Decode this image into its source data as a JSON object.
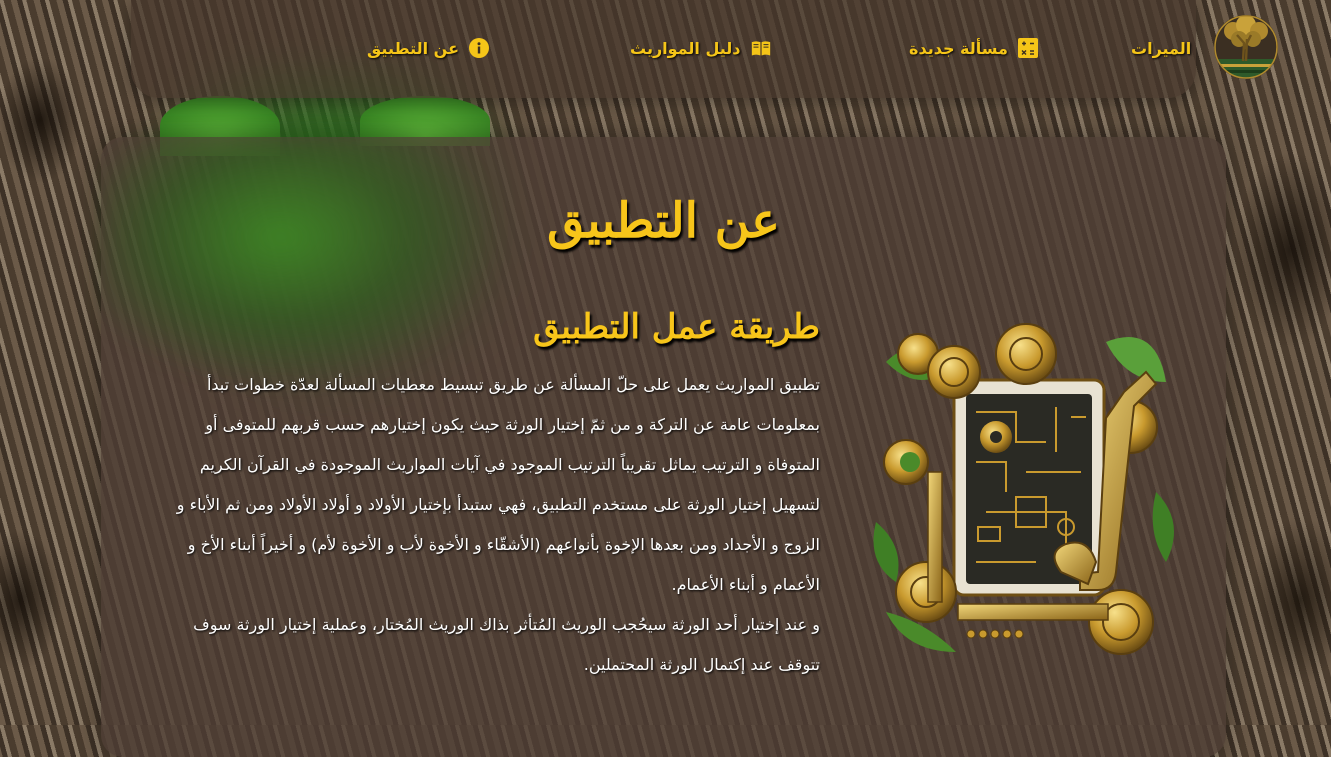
{
  "nav": {
    "logo_icon": "tree-of-life-logo-icon",
    "items": [
      {
        "label": "الميرات",
        "icon": ""
      },
      {
        "label": "مسألة جديدة",
        "icon": "calculator-icon"
      },
      {
        "label": "دليل المواريث",
        "icon": "open-book-icon"
      },
      {
        "label": "عن التطبيق",
        "icon": "info-circle-icon"
      }
    ]
  },
  "page": {
    "title": "عن التطبيق",
    "section_title": "طريقة عمل التطبيق",
    "paragraph1": "تطبيق المواريث يعمل على حلّ المسألة عن طريق تبسيط معطيات المسألة لعدّة خطوات تبدأ بمعلومات عامة عن التركة و من ثمّ إختيار الورثة حيث يكون إختيارهم حسب قربهم للمتوفى أو المتوفاة و الترتيب يماثل تقريباً الترتيب الموجود في آيات المواريث الموجودة في القرآن الكريم لتسهيل إختيار الورثة على مستخدم التطبيق، فهي ستبدأ بإختيار الأولاد و أولاد الأولاد ومن ثم الأباء و الزوج و الأجداد ومن بعدها الإخوة بأنواعهم (الأشقّاء و الأخوة لأب و الأخوة لأم) و أخيراً أبناء الأخ و الأعمام و أبناء الأعمام.",
    "paragraph2": "و عند إختيار أحد الورثة سيحُجب الوريث المُتأثر بذاك الوريث المُختار، وعملية إختيار الورثة سوف تتوقف عند إكتمال الورثة المحتملين.",
    "illustration_icon": "gears-tablet-illustration"
  },
  "colors": {
    "accent": "#f7c51a",
    "text": "#ffffff",
    "panel": "#4e3e34"
  }
}
